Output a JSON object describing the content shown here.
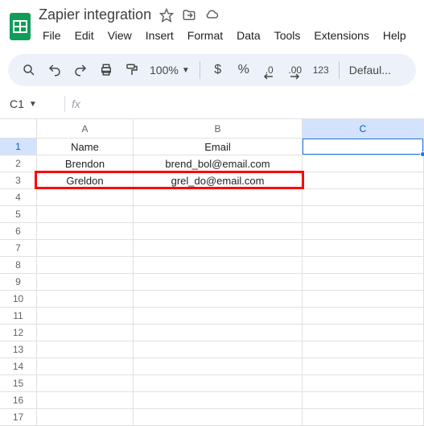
{
  "doc": {
    "title": "Zapier integration"
  },
  "menu": {
    "file": "File",
    "edit": "Edit",
    "view": "View",
    "insert": "Insert",
    "format": "Format",
    "data": "Data",
    "tools": "Tools",
    "extensions": "Extensions",
    "help": "Help"
  },
  "toolbar": {
    "zoom": "100%",
    "currency": "$",
    "percent": "%",
    "dec_dec": ".0",
    "dec_inc": ".00",
    "numfmt": "123",
    "font": "Defaul..."
  },
  "namebox": {
    "ref": "C1",
    "fx": "fx"
  },
  "columns": {
    "A": "A",
    "B": "B",
    "C": "C"
  },
  "rows": [
    "1",
    "2",
    "3",
    "4",
    "5",
    "6",
    "7",
    "8",
    "9",
    "10",
    "11",
    "12",
    "13",
    "14",
    "15",
    "16",
    "17"
  ],
  "cells": {
    "r1": {
      "A": "Name",
      "B": "Email"
    },
    "r2": {
      "A": "Brendon",
      "B": "brend_bol@email.com"
    },
    "r3": {
      "A": "Greldon",
      "B": "grel_do@email.com"
    }
  }
}
